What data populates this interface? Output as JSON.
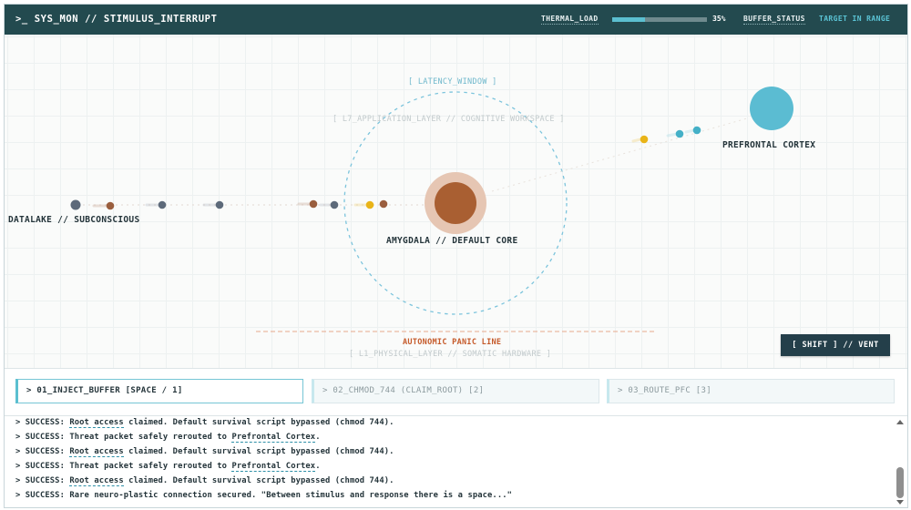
{
  "header": {
    "title": ">_ SYS_MON // STIMULUS_INTERRUPT",
    "thermal_label": "THERMAL_LOAD",
    "thermal_value": "35%",
    "thermal_fraction": 0.35,
    "buffer_label": "BUFFER_STATUS",
    "buffer_value": "TARGET IN RANGE"
  },
  "stage": {
    "latency_window": "[ LATENCY_WINDOW ]",
    "l7_layer": "[ L7_APPLICATION_LAYER // COGNITIVE WORKSPACE ]",
    "panic_line": "AUTONOMIC PANIC LINE",
    "l1_layer": "[ L1_PHYSICAL_LAYER // SOMATIC HARDWARE ]",
    "nodes": {
      "datalake": "DATALAKE // SUBCONSCIOUS",
      "amygdala": "AMYGDALA // DEFAULT CORE",
      "pfc": "PREFRONTAL CORTEX"
    },
    "vent_button": "[ SHIFT ] // VENT"
  },
  "actions": [
    {
      "label": "> 01_INJECT_BUFFER [SPACE / 1]",
      "active": true
    },
    {
      "label": "> 02_CHMOD_744 (CLAIM_ROOT) [2]",
      "active": false
    },
    {
      "label": "> 03_ROUTE_PFC [3]",
      "active": false
    }
  ],
  "log": {
    "lines": [
      {
        "prefix": "> SUCCESS: ",
        "link": "Root access",
        "rest": " claimed. Default survival script bypassed (chmod 744)."
      },
      {
        "prefix": "> SUCCESS: Threat packet safely rerouted to ",
        "link": "Prefrontal Cortex",
        "rest": "."
      },
      {
        "prefix": "> SUCCESS: ",
        "link": "Root access",
        "rest": " claimed. Default survival script bypassed (chmod 744)."
      },
      {
        "prefix": "> SUCCESS: Threat packet safely rerouted to ",
        "link": "Prefrontal Cortex",
        "rest": "."
      },
      {
        "prefix": "> SUCCESS: ",
        "link": "Root access",
        "rest": " claimed. Default survival script bypassed (chmod 744)."
      },
      {
        "prefix": "> SUCCESS: Rare neuro-plastic connection secured. \"Between stimulus and response there is a space...\"",
        "link": "",
        "rest": ""
      }
    ]
  },
  "colors": {
    "header_bg": "#234a4f",
    "accent_cyan": "#5bbfd0",
    "amygdala": "#a95f32",
    "amygdala_halo": "#e6c6b3",
    "pfc": "#5bbcd2",
    "packet_gold": "#e9b418",
    "packet_brown": "#9a5e3e",
    "packet_slate": "#5d6a7a",
    "panic": "#c55a2a"
  }
}
